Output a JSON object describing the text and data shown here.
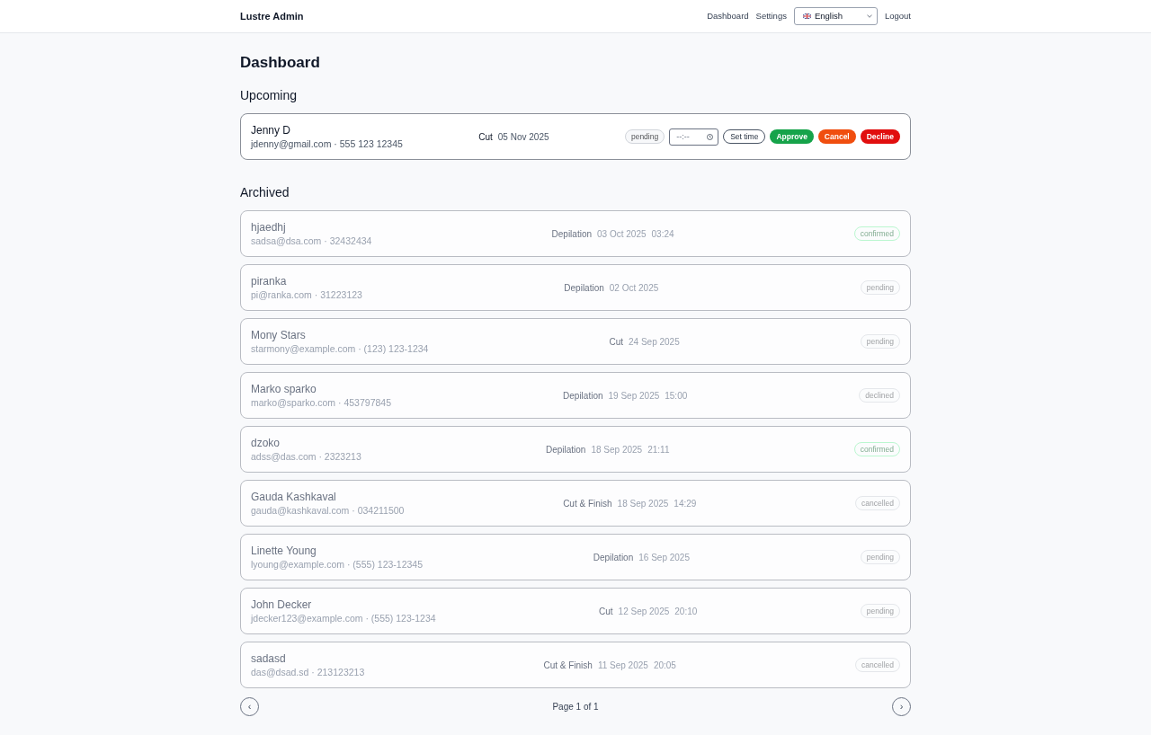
{
  "header": {
    "brand": "Lustre Admin",
    "nav": [
      {
        "label": "Dashboard"
      },
      {
        "label": "Settings"
      }
    ],
    "language_select": {
      "value": "English"
    },
    "logout": "Logout"
  },
  "page_title": "Dashboard",
  "upcoming": {
    "heading": "Upcoming",
    "items": [
      {
        "name": "Jenny D",
        "contact": "jdenny@gmail.com · 555 123 12345",
        "service": "Cut",
        "date": "05 Nov 2025",
        "status": {
          "label": "pending",
          "color": "#d1d5db"
        },
        "time_input": {
          "placeholder": "--:--"
        },
        "actions": [
          {
            "label": "Set time",
            "kind": "outline"
          },
          {
            "label": "Approve",
            "kind": "success"
          },
          {
            "label": "Cancel",
            "kind": "warning"
          },
          {
            "label": "Decline",
            "kind": "danger"
          }
        ]
      }
    ]
  },
  "archived": {
    "heading": "Archived",
    "items": [
      {
        "name": "hjaedhj",
        "contact": "sadsa@dsa.com · 32432434",
        "service": "Depilation",
        "date": "03 Oct 2025",
        "time": "03:24",
        "status": {
          "label": "confirmed",
          "color": "#bbf7d0"
        }
      },
      {
        "name": "piranka",
        "contact": "pi@ranka.com · 31223123",
        "service": "Depilation",
        "date": "02 Oct 2025",
        "status": {
          "label": "pending",
          "color": "#e5e7eb"
        }
      },
      {
        "name": "Mony Stars",
        "contact": "starmony@example.com · (123) 123-1234",
        "service": "Cut",
        "date": "24 Sep 2025",
        "status": {
          "label": "pending",
          "color": "#e5e7eb"
        }
      },
      {
        "name": "Marko sparko",
        "contact": "marko@sparko.com · 453797845",
        "service": "Depilation",
        "date": "19 Sep 2025",
        "time": "15:00",
        "status": {
          "label": "declined",
          "color": "#e5e7eb"
        }
      },
      {
        "name": "dzoko",
        "contact": "adss@das.com · 2323213",
        "service": "Depilation",
        "date": "18 Sep 2025",
        "time": "21:11",
        "status": {
          "label": "confirmed",
          "color": "#bbf7d0"
        }
      },
      {
        "name": "Gauda Kashkaval",
        "contact": "gauda@kashkaval.com · 034211500",
        "service": "Cut & Finish",
        "date": "18 Sep 2025",
        "time": "14:29",
        "status": {
          "label": "cancelled",
          "color": "#e5e7eb"
        }
      },
      {
        "name": "Linette Young",
        "contact": "lyoung@example.com · (555) 123-12345",
        "service": "Depilation",
        "date": "16 Sep 2025",
        "status": {
          "label": "pending",
          "color": "#e5e7eb"
        }
      },
      {
        "name": "John Decker",
        "contact": "jdecker123@example.com · (555) 123-1234",
        "service": "Cut",
        "date": "12 Sep 2025",
        "time": "20:10",
        "status": {
          "label": "pending",
          "color": "#e5e7eb"
        }
      },
      {
        "name": "sadasd",
        "contact": "das@dsad.sd · 213123213",
        "service": "Cut & Finish",
        "date": "11 Sep 2025",
        "time": "20:05",
        "status": {
          "label": "cancelled",
          "color": "#e5e7eb"
        }
      }
    ]
  },
  "pagination": {
    "previous": "‹",
    "label": "Page 1 of 1",
    "next": "›"
  }
}
